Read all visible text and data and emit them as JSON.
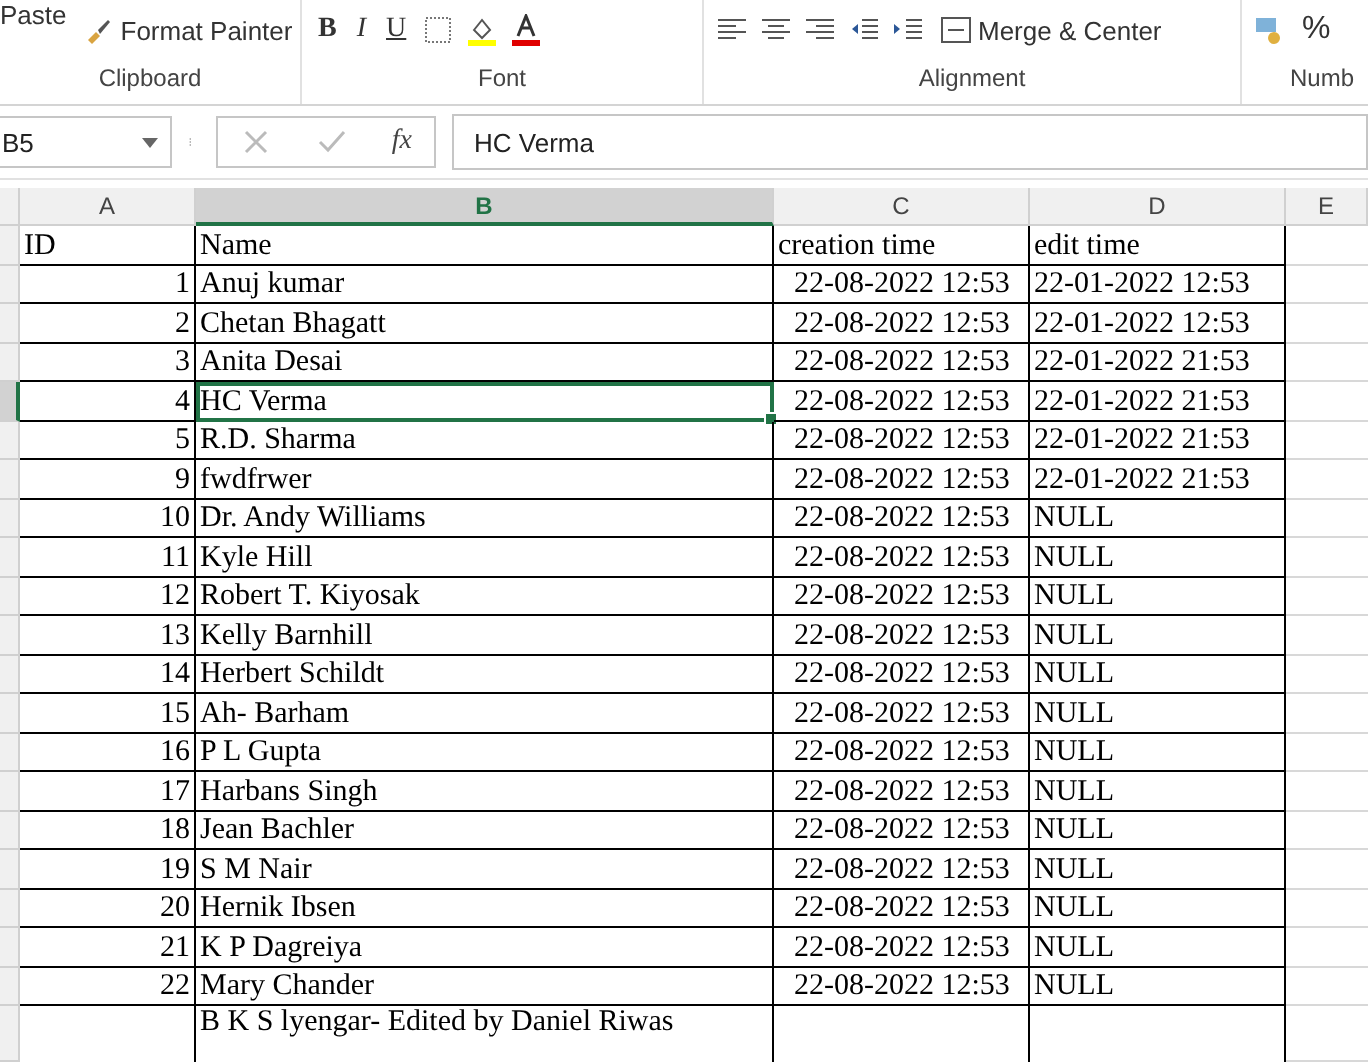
{
  "ribbon": {
    "paste_label": "Paste",
    "format_painter": "Format Painter",
    "font_buttons": [
      "B",
      "I",
      "U"
    ],
    "merge_label": "Merge & Center",
    "percent": "%",
    "groups": [
      "Clipboard",
      "Font",
      "Alignment",
      "Numb"
    ]
  },
  "formula_bar": {
    "name_box": "B5",
    "fx": "fx",
    "value": "HC Verma"
  },
  "columns": [
    {
      "label": "A",
      "selected": false
    },
    {
      "label": "B",
      "selected": true
    },
    {
      "label": "C",
      "selected": false
    },
    {
      "label": "D",
      "selected": false
    },
    {
      "label": "E",
      "selected": false
    }
  ],
  "rows": [
    {
      "cells": [
        "ID",
        "Name",
        "creation time",
        "edit time"
      ],
      "header": true,
      "selected": false
    },
    {
      "cells": [
        "1",
        "Anuj kumar",
        "22-08-2022 12:53",
        "22-01-2022 12:53"
      ],
      "selected": false
    },
    {
      "cells": [
        "2",
        "Chetan Bhagatt",
        "22-08-2022 12:53",
        "22-01-2022 12:53"
      ],
      "selected": false
    },
    {
      "cells": [
        "3",
        "Anita Desai",
        "22-08-2022 12:53",
        "22-01-2022 21:53"
      ],
      "selected": false
    },
    {
      "cells": [
        "4",
        "HC Verma",
        "22-08-2022 12:53",
        "22-01-2022 21:53"
      ],
      "selected": true
    },
    {
      "cells": [
        "5",
        "R.D. Sharma",
        "22-08-2022 12:53",
        "22-01-2022 21:53"
      ],
      "selected": false
    },
    {
      "cells": [
        "9",
        "fwdfrwer",
        "22-08-2022 12:53",
        "22-01-2022 21:53"
      ],
      "selected": false
    },
    {
      "cells": [
        "10",
        "Dr. Andy Williams",
        "22-08-2022 12:53",
        "NULL"
      ],
      "selected": false
    },
    {
      "cells": [
        "11",
        "Kyle Hill",
        "22-08-2022 12:53",
        "NULL"
      ],
      "selected": false
    },
    {
      "cells": [
        "12",
        "Robert T. Kiyosak",
        "22-08-2022 12:53",
        "NULL"
      ],
      "selected": false
    },
    {
      "cells": [
        "13",
        "Kelly Barnhill",
        "22-08-2022 12:53",
        "NULL"
      ],
      "selected": false
    },
    {
      "cells": [
        "14",
        "Herbert Schildt",
        "22-08-2022 12:53",
        "NULL"
      ],
      "selected": false
    },
    {
      "cells": [
        "15",
        "Ah- Barham",
        "22-08-2022 12:53",
        "NULL"
      ],
      "selected": false
    },
    {
      "cells": [
        "16",
        "P L Gupta",
        "22-08-2022 12:53",
        "NULL"
      ],
      "selected": false
    },
    {
      "cells": [
        "17",
        "Harbans Singh",
        "22-08-2022 12:53",
        "NULL"
      ],
      "selected": false
    },
    {
      "cells": [
        "18",
        "Jean Bachler",
        "22-08-2022 12:53",
        "NULL"
      ],
      "selected": false
    },
    {
      "cells": [
        "19",
        "S M Nair",
        "22-08-2022 12:53",
        "NULL"
      ],
      "selected": false
    },
    {
      "cells": [
        "20",
        "Hernik Ibsen",
        "22-08-2022 12:53",
        "NULL"
      ],
      "selected": false
    },
    {
      "cells": [
        "21",
        "K P Dagreiya",
        "22-08-2022 12:53",
        "NULL"
      ],
      "selected": false
    },
    {
      "cells": [
        "22",
        "Mary Chander",
        "22-08-2022 12:53",
        "NULL"
      ],
      "selected": false
    },
    {
      "cells": [
        "",
        "B K S lyengar- Edited by Daniel Riwas",
        "",
        ""
      ],
      "tall": true,
      "selected": false
    }
  ]
}
